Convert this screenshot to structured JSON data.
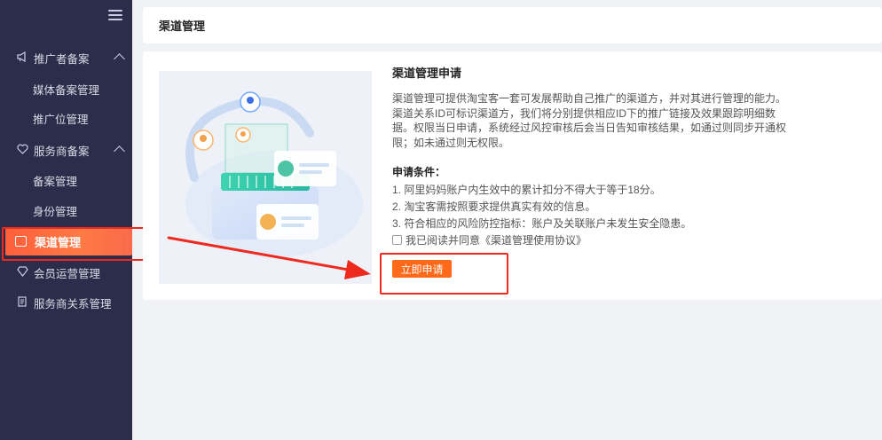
{
  "sidebar": {
    "groups": [
      {
        "label": "推广者备案",
        "icon": "megaphone-icon",
        "items": [
          {
            "label": "媒体备案管理"
          },
          {
            "label": "推广位管理"
          }
        ]
      },
      {
        "label": "服务商备案",
        "icon": "heart-shield-icon",
        "items": [
          {
            "label": "备案管理"
          },
          {
            "label": "身份管理"
          }
        ]
      }
    ],
    "active": {
      "label": "渠道管理",
      "icon": "channel-icon"
    },
    "others": [
      {
        "label": "会员运营管理",
        "icon": "diamond-icon"
      },
      {
        "label": "服务商关系管理",
        "icon": "document-icon"
      }
    ]
  },
  "header": {
    "title": "渠道管理"
  },
  "content": {
    "heading": "渠道管理申请",
    "description": [
      "渠道管理可提供淘宝客一套可发展帮助自己推广的渠道方，并对其进行管理的能力。",
      "渠道关系ID可标识渠道方，我们将分别提供相应ID下的推广链接及效果跟踪明细数",
      "据。权限当日申请，系统经过风控审核后会当日告知审核结果，如通过则同步开通权",
      "限；如未通过则无权限。"
    ],
    "conditions_title": "申请条件：",
    "conditions": [
      "1. 阿里妈妈账户内生效中的累计扣分不得大于等于18分。",
      "2. 淘宝客需按照要求提供真实有效的信息。",
      "3. 符合相应的风险防控指标：账户及关联账户未发生安全隐患。"
    ],
    "agreement": "我已阅读并同意《渠道管理使用协议》",
    "apply_button": "立即申请"
  },
  "colors": {
    "sidebar_bg": "#2b2d4a",
    "accent": "#ff6a1a",
    "annotation_red": "#ee2a1f"
  }
}
